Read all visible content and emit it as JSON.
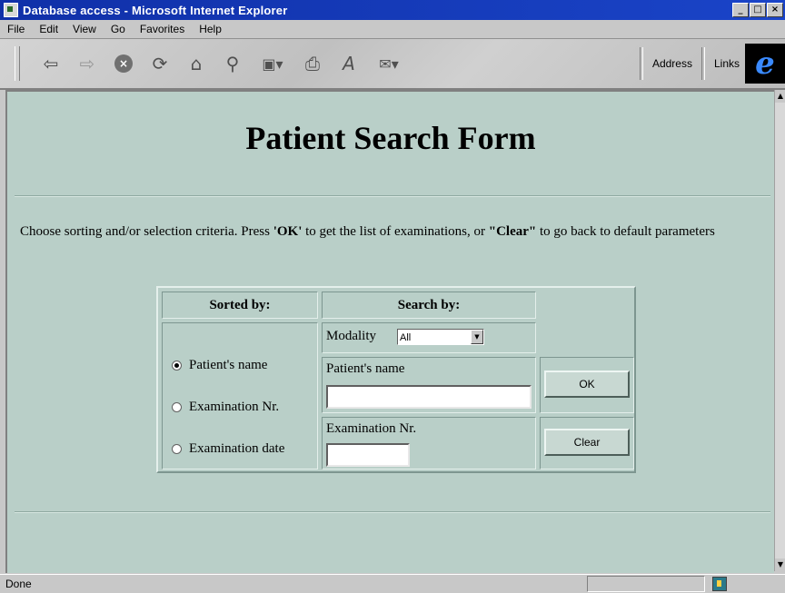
{
  "window": {
    "title": "Database access - Microsoft Internet Explorer",
    "buttons": {
      "minimize": "_",
      "maximize": "□",
      "close": "×"
    }
  },
  "menubar": {
    "items": [
      "File",
      "Edit",
      "View",
      "Go",
      "Favorites",
      "Help"
    ]
  },
  "toolbar": {
    "buttons": [
      {
        "name": "back-icon",
        "glyph": "⇦"
      },
      {
        "name": "forward-icon",
        "glyph": "⇨"
      },
      {
        "name": "stop-icon",
        "glyph": "×"
      },
      {
        "name": "refresh-icon",
        "glyph": "⟳"
      },
      {
        "name": "home-icon",
        "glyph": "⌂"
      },
      {
        "name": "search-icon",
        "glyph": "⚲"
      },
      {
        "name": "favorites-icon",
        "glyph": "▣▾"
      },
      {
        "name": "print-icon",
        "glyph": "⎙"
      },
      {
        "name": "font-icon",
        "glyph": "A"
      },
      {
        "name": "mail-icon",
        "glyph": "✉▾"
      }
    ],
    "address_label": "Address",
    "links_label": "Links",
    "logo": "e"
  },
  "page": {
    "title": "Patient Search Form",
    "instructions": {
      "part1": "Choose sorting and/or selection criteria. Press ",
      "ok_label": "'OK'",
      "part2": " to get the list of examinations, or ",
      "clear_label": "\"Clear\"",
      "part3": " to go back to default parameters"
    },
    "form": {
      "sorted_by_header": "Sorted by:",
      "search_by_header": "Search by:",
      "sort_options": [
        {
          "label": "Patient's name",
          "checked": true
        },
        {
          "label": "Examination Nr.",
          "checked": false
        },
        {
          "label": "Examination date",
          "checked": false
        }
      ],
      "modality_label": "Modality",
      "modality_value": "All",
      "patient_name_label": "Patient's name",
      "patient_name_value": "",
      "exam_nr_label": "Examination Nr.",
      "exam_nr_value": "",
      "ok_button": "OK",
      "clear_button": "Clear"
    }
  },
  "statusbar": {
    "text": "Done"
  }
}
